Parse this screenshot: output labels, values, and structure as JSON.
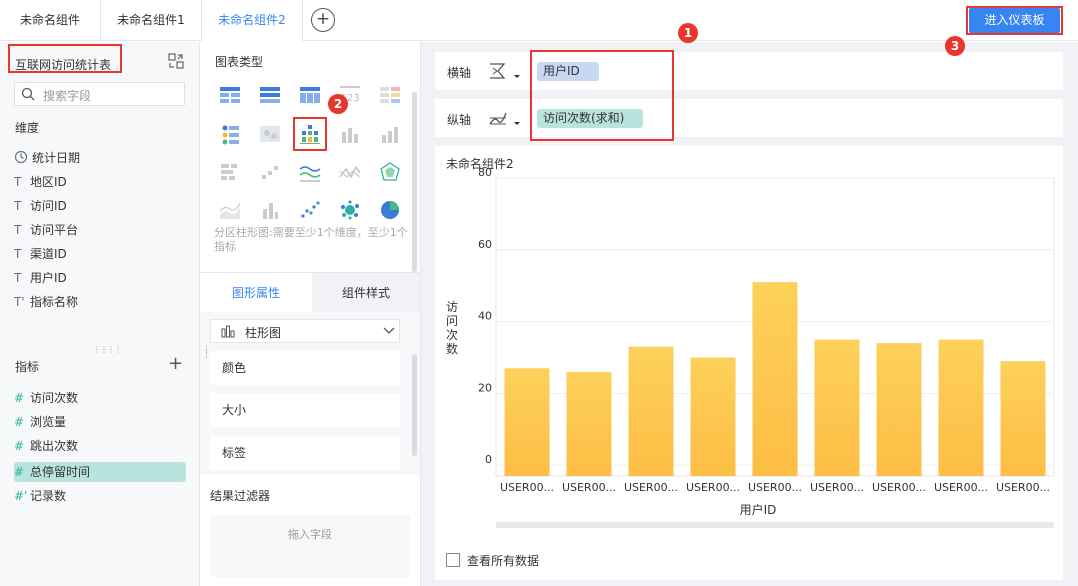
{
  "tabs": [
    {
      "label": "未命名组件"
    },
    {
      "label": "未命名组件1"
    },
    {
      "label": "未命名组件2"
    }
  ],
  "enter_dashboard_label": "进入仪表板",
  "badges": [
    "1",
    "2",
    "3"
  ],
  "left": {
    "dataset_title": "互联网访问统计表",
    "search_placeholder": "搜索字段",
    "dimensions_label": "维度",
    "dimensions": [
      {
        "type": "date",
        "icon": "clock-icon",
        "label": "统计日期"
      },
      {
        "type": "text",
        "icon": "T",
        "label": "地区ID"
      },
      {
        "type": "text",
        "icon": "T",
        "label": "访问ID"
      },
      {
        "type": "text",
        "icon": "T",
        "label": "访问平台"
      },
      {
        "type": "text",
        "icon": "T",
        "label": "渠道ID"
      },
      {
        "type": "text",
        "icon": "T",
        "label": "用户ID"
      },
      {
        "type": "text-calc",
        "icon": "T'",
        "label": "指标名称"
      }
    ],
    "measures_label": "指标",
    "measures": [
      {
        "icon": "#",
        "label": "访问次数"
      },
      {
        "icon": "#",
        "label": "浏览量"
      },
      {
        "icon": "#",
        "label": "跳出次数"
      },
      {
        "icon": "#",
        "label": "总停留时间",
        "selected": true
      },
      {
        "icon": "#'",
        "label": "记录数"
      }
    ]
  },
  "middle": {
    "chart_types_title": "图表类型",
    "chart_type_hint": "分区柱形图:需要至少1个维度，至少1个指标",
    "tab_shape": "图形属性",
    "tab_style": "组件样式",
    "shape_select": "柱形图",
    "props": [
      "颜色",
      "大小",
      "标签"
    ],
    "filter_title": "结果过滤器",
    "filter_placeholder": "拖入字段"
  },
  "right": {
    "x_axis_label": "横轴",
    "x_axis_field": "用户ID",
    "y_axis_label": "纵轴",
    "y_axis_field": "访问次数(求和)",
    "chart_title": "未命名组件2",
    "show_all_label": "查看所有数据",
    "colors": {
      "bar_top": "#fdd15a",
      "bar_bottom": "#fdbd45",
      "x_pill": "#c8d8f2",
      "y_pill": "#b9e3dd",
      "accent": "#3685f2",
      "annot": "#e8362c"
    }
  },
  "chart_data": {
    "type": "bar",
    "categories": [
      "USER00...",
      "USER00...",
      "USER00...",
      "USER00...",
      "USER00...",
      "USER00...",
      "USER00...",
      "USER00...",
      "USER00..."
    ],
    "values": [
      27,
      26,
      33,
      30,
      51,
      35,
      34,
      35,
      29
    ],
    "xlabel": "用户ID",
    "ylabel": "访问次数",
    "yticks": [
      0,
      20,
      40,
      60,
      80
    ],
    "ylim": [
      -3,
      80
    ],
    "grid": true
  }
}
